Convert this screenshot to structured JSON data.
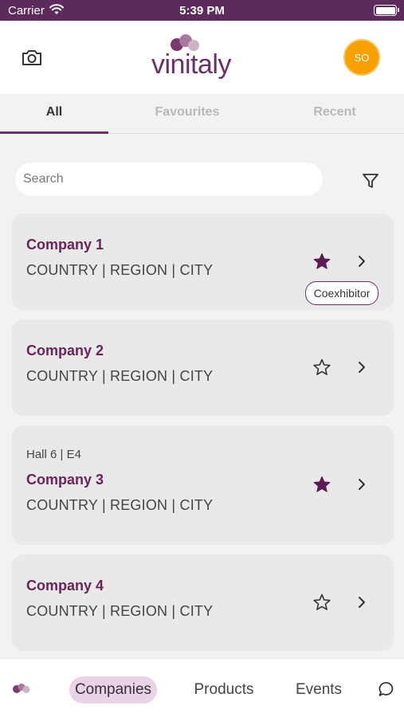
{
  "status_bar": {
    "carrier": "Carrier",
    "time": "5:39 PM"
  },
  "header": {
    "logo_text": "vinitaly",
    "avatar_initials": "SO"
  },
  "tabs": [
    {
      "label": "All",
      "active": true
    },
    {
      "label": "Favourites",
      "active": false
    },
    {
      "label": "Recent",
      "active": false
    }
  ],
  "search": {
    "placeholder": "Search",
    "value": ""
  },
  "companies": [
    {
      "name": "Company 1",
      "location": "COUNTRY | REGION | CITY",
      "favourite": true,
      "badge": "Coexhibitor"
    },
    {
      "name": "Company 2",
      "location": "COUNTRY | REGION | CITY",
      "favourite": false
    },
    {
      "hall": "Hall 6   | E4",
      "name": "Company 3",
      "location": "COUNTRY | REGION | CITY",
      "favourite": true
    },
    {
      "name": "Company 4",
      "location": "COUNTRY | REGION | CITY",
      "favourite": false
    }
  ],
  "bottom_nav": {
    "companies": "Companies",
    "products": "Products",
    "events": "Events"
  },
  "colors": {
    "brand": "#6b2f6a",
    "status_bar": "#5d2a5c",
    "avatar": "#f6a100",
    "company_name": "#6b2358"
  },
  "icons": {
    "camera": "camera-icon",
    "filter": "filter-icon",
    "star": "star-icon",
    "chevron": "chevron-right-icon",
    "chat": "chat-icon"
  }
}
